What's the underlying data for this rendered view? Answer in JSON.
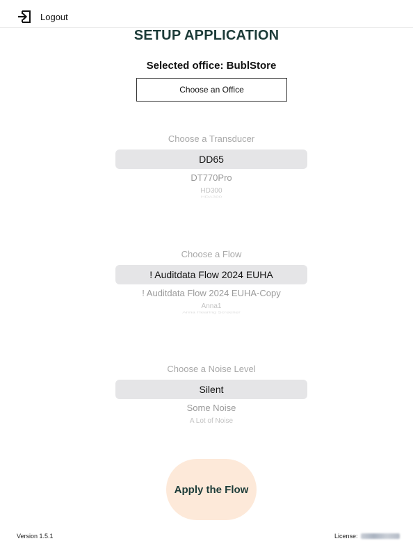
{
  "header": {
    "logout_label": "Logout",
    "logout_icon": "logout-icon"
  },
  "title": "SETUP APPLICATION",
  "office": {
    "selected_label": "Selected office: BublStore",
    "choose_button": "Choose an Office"
  },
  "transducer_picker": {
    "label": "Choose a Transducer",
    "options": [
      "DD65",
      "DT770Pro",
      "HD300",
      "HDA300"
    ],
    "selected": "DD65"
  },
  "flow_picker": {
    "label": "Choose a Flow",
    "options": [
      "! Auditdata Flow 2024 EUHA",
      "! Auditdata Flow 2024 EUHA-Copy",
      "Anna1",
      "Anna Hearing Screener"
    ],
    "selected": "! Auditdata Flow 2024 EUHA"
  },
  "noise_picker": {
    "label": "Choose a Noise Level",
    "options": [
      "Silent",
      "Some Noise",
      "A Lot of Noise"
    ],
    "selected": "Silent"
  },
  "apply_button": "Apply the Flow",
  "footer": {
    "version": "Version 1.5.1",
    "license_label": "License:"
  },
  "colors": {
    "title": "#1c3b38",
    "apply_bg": "#fde9d9",
    "selected_option_bg": "#e5e5e7",
    "faded_text": "#a8a8a8"
  }
}
